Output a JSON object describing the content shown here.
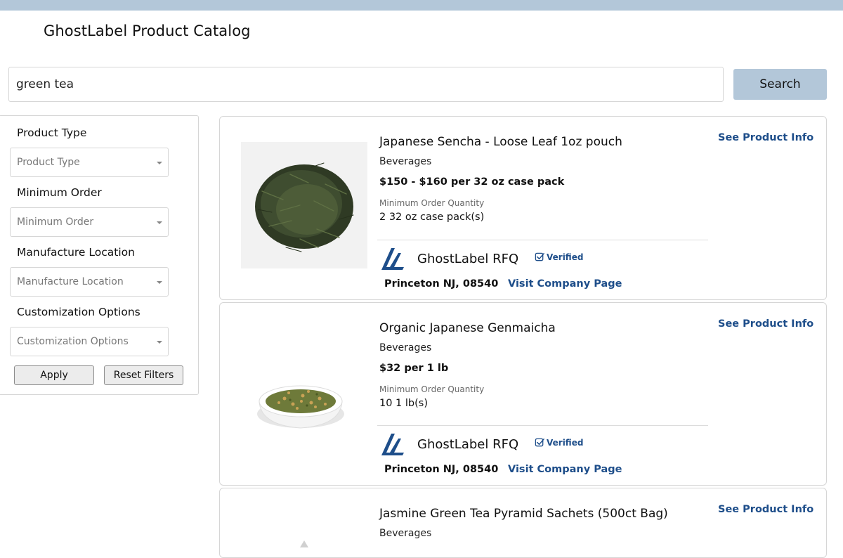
{
  "page": {
    "title": "GhostLabel Product Catalog"
  },
  "search": {
    "value": "green tea",
    "button_label": "Search"
  },
  "filters": {
    "product_type": {
      "label": "Product Type",
      "placeholder": "Product Type"
    },
    "minimum_order": {
      "label": "Minimum Order",
      "placeholder": "Minimum Order"
    },
    "manufacture_location": {
      "label": "Manufacture Location",
      "placeholder": "Manufacture Location"
    },
    "customization_options": {
      "label": "Customization Options",
      "placeholder": "Customization Options"
    },
    "apply_label": "Apply",
    "reset_label": "Reset Filters"
  },
  "products": [
    {
      "name": "Japanese Sencha - Loose Leaf 1oz pouch",
      "category": "Beverages",
      "price": "$150 - $160 per 32 oz case pack",
      "moq_label": "Minimum Order Quantity",
      "moq_value": "2 32 oz case pack(s)",
      "info_link": "See Product Info",
      "company": "GhostLabel RFQ",
      "verified": "Verified",
      "location": "Princeton NJ, 08540",
      "company_link": "Visit Company Page",
      "image_icon": "loose-leaf-tea-image"
    },
    {
      "name": "Organic Japanese Genmaicha",
      "category": "Beverages",
      "price": "$32 per 1 lb",
      "moq_label": "Minimum Order Quantity",
      "moq_value": "10 1 lb(s)",
      "info_link": "See Product Info",
      "company": "GhostLabel RFQ",
      "verified": "Verified",
      "location": "Princeton NJ, 08540",
      "company_link": "Visit Company Page",
      "image_icon": "genmaicha-bowl-image"
    },
    {
      "name": "Jasmine Green Tea Pyramid Sachets (500ct Bag)",
      "category": "Beverages",
      "info_link": "See Product Info",
      "image_icon": "image-placeholder"
    }
  ],
  "colors": {
    "accent": "#b3c7d9",
    "link": "#1e4e8a",
    "logo": "#1e4e8a"
  }
}
